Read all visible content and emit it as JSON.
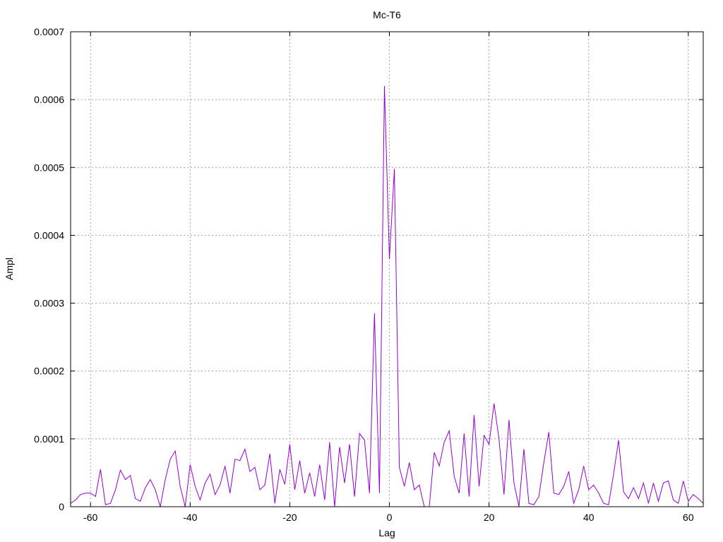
{
  "chart_data": {
    "type": "line",
    "title": "Mc-T6",
    "xlabel": "Lag",
    "ylabel": "Ampl",
    "xlim": [
      -64,
      63
    ],
    "ylim": [
      0,
      0.0007
    ],
    "grid": true,
    "legend": "none",
    "x_ticks": [
      -60,
      -40,
      -20,
      0,
      20,
      40,
      60
    ],
    "y_ticks": [
      0,
      0.0001,
      0.0002,
      0.0003,
      0.0004,
      0.0005,
      0.0006,
      0.0007
    ],
    "y_tick_labels": [
      "0",
      "0.0001",
      "0.0002",
      "0.0003",
      "0.0004",
      "0.0005",
      "0.0006",
      "0.0007"
    ],
    "series": [
      {
        "color": "#9400d3",
        "x": [
          -64,
          -63,
          -62,
          -61,
          -60,
          -59,
          -58,
          -57,
          -56,
          -55,
          -54,
          -53,
          -52,
          -51,
          -50,
          -49,
          -48,
          -47,
          -46,
          -45,
          -44,
          -43,
          -42,
          -41,
          -40,
          -39,
          -38,
          -37,
          -36,
          -35,
          -34,
          -33,
          -32,
          -31,
          -30,
          -29,
          -28,
          -27,
          -26,
          -25,
          -24,
          -23,
          -22,
          -21,
          -20,
          -19,
          -18,
          -17,
          -16,
          -15,
          -14,
          -13,
          -12,
          -11,
          -10,
          -9,
          -8,
          -7,
          -6,
          -5,
          -4,
          -3,
          -2,
          -1,
          0,
          1,
          2,
          3,
          4,
          5,
          6,
          7,
          8,
          9,
          10,
          11,
          12,
          13,
          14,
          15,
          16,
          17,
          18,
          19,
          20,
          21,
          22,
          23,
          24,
          25,
          26,
          27,
          28,
          29,
          30,
          31,
          32,
          33,
          34,
          35,
          36,
          37,
          38,
          39,
          40,
          41,
          42,
          43,
          44,
          45,
          46,
          47,
          48,
          49,
          50,
          51,
          52,
          53,
          54,
          55,
          56,
          57,
          58,
          59,
          60,
          61,
          62,
          63
        ],
        "y": [
          5e-06,
          1e-05,
          1.8e-05,
          2e-05,
          2e-05,
          1.5e-05,
          5.5e-05,
          3e-06,
          5e-06,
          2.5e-05,
          5.4e-05,
          4e-05,
          4.6e-05,
          1.2e-05,
          8e-06,
          2.8e-05,
          4e-05,
          2.5e-05,
          0.0,
          4e-05,
          7e-05,
          8.2e-05,
          3e-05,
          0.0,
          6.2e-05,
          3e-05,
          1e-05,
          3.5e-05,
          4.8e-05,
          1.8e-05,
          3.2e-05,
          6e-05,
          2e-05,
          7e-05,
          6.8e-05,
          8.5e-05,
          5.2e-05,
          5.8e-05,
          2.5e-05,
          3.2e-05,
          7.8e-05,
          5e-06,
          5.5e-05,
          3.3e-05,
          9.2e-05,
          2.5e-05,
          6.8e-05,
          2e-05,
          5e-05,
          1.5e-05,
          6.2e-05,
          1e-05,
          9.5e-05,
          0.0,
          8.8e-05,
          3.5e-05,
          9.2e-05,
          1.5e-05,
          0.000108,
          9.8e-05,
          2e-05,
          0.000285,
          2e-05,
          0.00062,
          0.000365,
          0.000498,
          5.8e-05,
          3e-05,
          6.5e-05,
          2.5e-05,
          3.2e-05,
          0.0,
          0.0,
          8e-05,
          6e-05,
          9.5e-05,
          0.000112,
          4.5e-05,
          2e-05,
          0.000108,
          1.5e-05,
          0.000135,
          3e-05,
          0.000105,
          9.2e-05,
          0.000152,
          0.0001,
          1.8e-05,
          0.000128,
          3.5e-05,
          0.0,
          8.5e-05,
          5e-06,
          3e-06,
          1.5e-05,
          6.5e-05,
          0.00011,
          2e-05,
          1.8e-05,
          3e-05,
          5.2e-05,
          5e-06,
          2.5e-05,
          6e-05,
          2.5e-05,
          3.2e-05,
          2e-05,
          5e-06,
          3e-06,
          4.8e-05,
          9.8e-05,
          2.2e-05,
          1.2e-05,
          2.8e-05,
          1.2e-05,
          3.5e-05,
          5e-06,
          3.5e-05,
          8e-06,
          3.5e-05,
          3.8e-05,
          1e-05,
          5e-06,
          3.8e-05,
          8e-06,
          1.8e-05,
          1.2e-05,
          5e-06
        ]
      }
    ]
  }
}
